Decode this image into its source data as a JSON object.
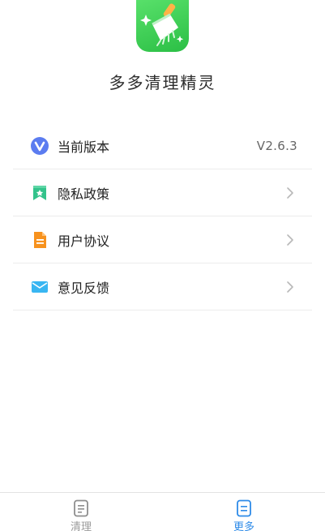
{
  "app": {
    "name": "多多清理精灵",
    "icon": "broom-app-icon"
  },
  "menu": {
    "items": [
      {
        "label": "当前版本",
        "value": "V2.6.3",
        "icon": "version-v-icon",
        "icon_color": "#5b7cf0"
      },
      {
        "label": "隐私政策",
        "icon": "bookmark-star-icon",
        "icon_color": "#33c38b"
      },
      {
        "label": "用户协议",
        "icon": "document-icon",
        "icon_color": "#f7921e"
      },
      {
        "label": "意见反馈",
        "icon": "mail-icon",
        "icon_color": "#39b6f2"
      }
    ]
  },
  "tabbar": {
    "tabs": [
      {
        "label": "清理",
        "icon": "list-doc-icon",
        "active": false
      },
      {
        "label": "更多",
        "icon": "more-doc-icon",
        "active": true
      }
    ],
    "active_color": "#2e8be8",
    "inactive_color": "#9a9a9a"
  }
}
